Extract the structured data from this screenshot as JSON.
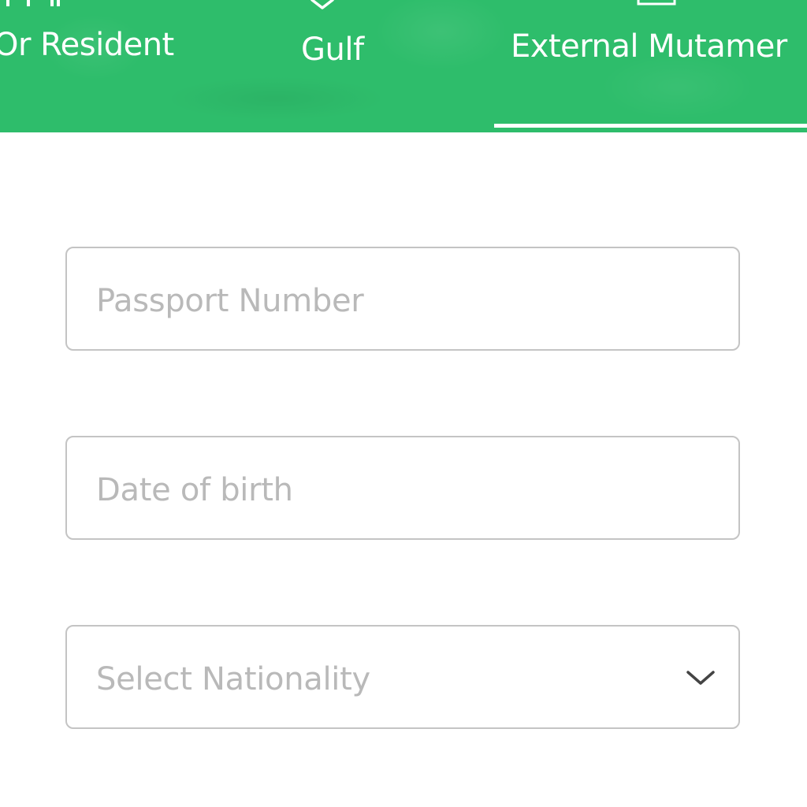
{
  "tabs": [
    {
      "label": "Or Resident",
      "icon": "id-card-icon"
    },
    {
      "label": "Gulf",
      "icon": "location-pin-icon"
    },
    {
      "label": "External Mutamer",
      "icon": "passport-icon",
      "active": true
    }
  ],
  "form": {
    "passport_placeholder": "Passport Number",
    "dob_placeholder": "Date of birth",
    "nationality_placeholder": "Select Nationality"
  },
  "colors": {
    "header_green": "#2ebd6b",
    "border_gray": "#c4c4c4",
    "placeholder_gray": "#b9b9b9"
  }
}
